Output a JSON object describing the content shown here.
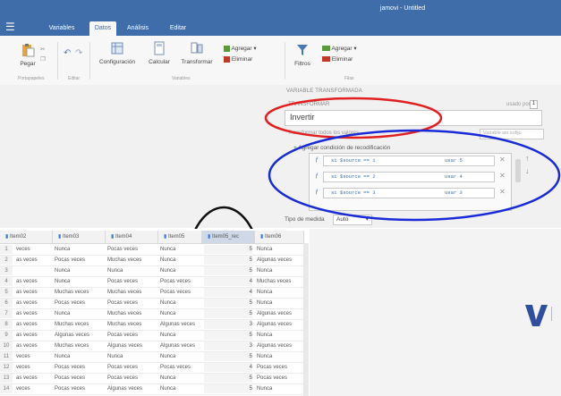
{
  "app": {
    "title": "jamovi - Untitled"
  },
  "tabs": [
    {
      "label": "Variables"
    },
    {
      "label": "Datos"
    },
    {
      "label": "Análisis"
    },
    {
      "label": "Editar"
    }
  ],
  "ribbon": {
    "pegar": "Pegar",
    "portapapeles": "Portapapeles",
    "editar": "Editar",
    "configuracion": "Configuración",
    "calcular": "Calcular",
    "transformar": "Transformar",
    "variables_group": "Variables",
    "agregar1": "Agregar",
    "eliminar1": "Eliminar",
    "filtros": "Filtros",
    "agregar2": "Agregar",
    "eliminar2": "Eliminar",
    "filas_group": "Filas"
  },
  "transform": {
    "section_title": "VARIABLE TRANSFORMADA",
    "transformar_label": "TRANSFORMAR",
    "usado_por": "usado por",
    "usado_por_count": "1",
    "name_value": "Invertir",
    "describe_placeholder": "Describe la transformación",
    "tab_label": "Transformar todos los valores",
    "suffix_placeholder": "Variable sin sufijo",
    "add_condition": "Agregar condición de recodificación",
    "conditions": [
      {
        "fx": "ƒ",
        "expr": "si $source == 1",
        "use": "usar 5"
      },
      {
        "fx": "ƒ",
        "expr": "si $source == 2",
        "use": "usar 4"
      },
      {
        "fx": "ƒ",
        "expr": "si $source == 3",
        "use": "usar 3"
      }
    ],
    "measure_label": "Tipo de medida",
    "measure_value": "Auto"
  },
  "table": {
    "columns": [
      "Item02",
      "Item03",
      "Item04",
      "Item05",
      "Item05_rec",
      "Item06"
    ],
    "rows": [
      [
        "veces",
        "Nunca",
        "Pocas veces",
        "Nunca",
        "5",
        "Nunca"
      ],
      [
        "as veces",
        "Pocas veces",
        "Muchas veces",
        "Nunca",
        "5",
        "Algunas veces"
      ],
      [
        "",
        "Nunca",
        "Nunca",
        "Nunca",
        "5",
        "Nunca"
      ],
      [
        "as veces",
        "Nunca",
        "Pocas veces",
        "Pocas veces",
        "4",
        "Muchas veces"
      ],
      [
        "as veces",
        "Muchas veces",
        "Muchas veces",
        "Pocas veces",
        "4",
        "Nunca"
      ],
      [
        "as veces",
        "Pocas veces",
        "Pocas veces",
        "Nunca",
        "5",
        "Nunca"
      ],
      [
        "as veces",
        "Nunca",
        "Muchas veces",
        "Nunca",
        "5",
        "Algunas veces"
      ],
      [
        "as veces",
        "Muchas veces",
        "Muchas veces",
        "Algunas veces",
        "3",
        "Algunas veces"
      ],
      [
        "as veces",
        "Algunas veces",
        "Pocas veces",
        "Nunca",
        "5",
        "Nunca"
      ],
      [
        "as veces",
        "Muchas veces",
        "Algunas veces",
        "Algunas veces",
        "3",
        "Algunas veces"
      ],
      [
        "veces",
        "Nunca",
        "Nunca",
        "Nunca",
        "5",
        "Nunca"
      ],
      [
        "veces",
        "Pocas veces",
        "Pocas veces",
        "Pocas veces",
        "4",
        "Pocas veces"
      ],
      [
        "as veces",
        "Pocas veces",
        "Pocas veces",
        "Nunca",
        "5",
        "Pocas veces"
      ],
      [
        "veces",
        "Pocas veces",
        "Algunas veces",
        "Nunca",
        "5",
        "Nunca"
      ]
    ],
    "row_numbers": [
      "1",
      "2",
      "3",
      "4",
      "5",
      "6",
      "7",
      "8",
      "9",
      "10",
      "11",
      "12",
      "13",
      "14"
    ]
  },
  "colors": {
    "brand": "#3e6da9",
    "annotation_red": "#e02020",
    "annotation_blue": "#1a2bd6",
    "annotation_black": "#111111"
  }
}
